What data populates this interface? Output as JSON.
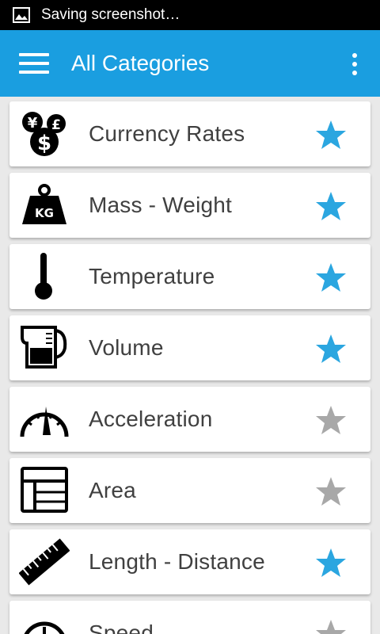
{
  "status_bar": {
    "text": "Saving screenshot…"
  },
  "app_bar": {
    "title": "All Categories"
  },
  "colors": {
    "accent": "#1a9ee0",
    "star_active": "#2ba6e0",
    "star_inactive": "#a8a8a8",
    "text": "#404040"
  },
  "categories": [
    {
      "label": "Currency Rates",
      "icon": "currency-icon",
      "favorite": true
    },
    {
      "label": "Mass - Weight",
      "icon": "weight-icon",
      "favorite": true
    },
    {
      "label": "Temperature",
      "icon": "thermometer-icon",
      "favorite": true
    },
    {
      "label": "Volume",
      "icon": "measuring-cup-icon",
      "favorite": true
    },
    {
      "label": "Acceleration",
      "icon": "speedometer-icon",
      "favorite": false
    },
    {
      "label": "Area",
      "icon": "area-icon",
      "favorite": false
    },
    {
      "label": "Length - Distance",
      "icon": "ruler-icon",
      "favorite": true
    },
    {
      "label": "Speed",
      "icon": "speed-icon",
      "favorite": false
    }
  ]
}
